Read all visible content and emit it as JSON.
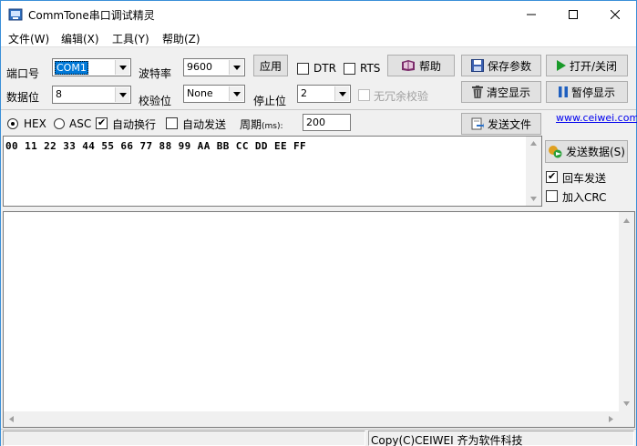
{
  "window": {
    "title": "CommTone串口调试精灵",
    "minimize_label": "—",
    "maximize_label": "☐",
    "close_label": "✕"
  },
  "menu": [
    "文件(W)",
    "编辑(X)",
    "工具(Y)",
    "帮助(Z)"
  ],
  "settings": {
    "port_label": "端口号",
    "port_value": "COM1",
    "baud_label": "波特率",
    "baud_value": "9600",
    "apply_label": "应用",
    "dtr_label": "DTR",
    "rts_label": "RTS",
    "databits_label": "数据位",
    "databits_value": "8",
    "parity_label": "校验位",
    "parity_value": "None",
    "stopbits_label": "停止位",
    "stopbits_value": "2",
    "redundant_check_label": "无冗余校验"
  },
  "toolbar": {
    "help_label": "帮助",
    "save_params_label": "保存参数",
    "open_close_label": "打开/关闭",
    "clear_label": "清空显示",
    "pause_label": "暂停显示"
  },
  "send_options": {
    "hex_label": "HEX",
    "asc_label": "ASC",
    "wrap_label": "自动换行",
    "auto_send_label": "自动发送",
    "period_label": "周期",
    "period_unit": "(ms):",
    "period_value": "200",
    "send_file_label": "发送文件",
    "website": "www.ceiwei.com"
  },
  "send_panel": {
    "data": "00 11 22 33 44 55 66 77 88 99 AA BB CC DD EE FF",
    "send_button_label": "发送数据(S)",
    "enter_send_label": "回车发送",
    "add_crc_label": "加入CRC"
  },
  "status": {
    "copyright": "Copy(C)CEIWEI 齐为软件科技"
  },
  "colors": {
    "accent": "#0078d7",
    "link": "#0000ee"
  }
}
